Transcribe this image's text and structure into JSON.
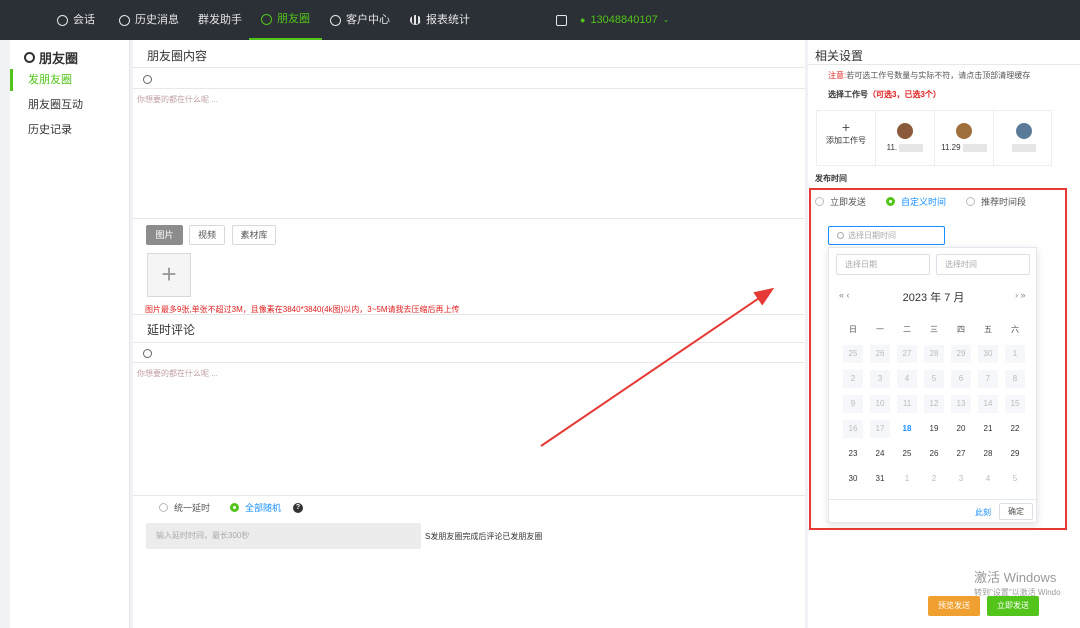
{
  "topnav": {
    "items": [
      {
        "label": "会话",
        "icon": "chat-icon"
      },
      {
        "label": "历史消息",
        "icon": "clock-icon"
      },
      {
        "label": "群发助手",
        "icon": ""
      },
      {
        "label": "朋友圈",
        "icon": "moments-icon",
        "active": true
      },
      {
        "label": "客户中心",
        "icon": "user-icon"
      },
      {
        "label": "报表统计",
        "icon": "bar-chart-icon"
      }
    ],
    "account_phone": "13048840107",
    "accent_color": "#52c41a"
  },
  "sidebar": {
    "title": "朋友圈",
    "items": [
      {
        "label": "发朋友圈",
        "active": true
      },
      {
        "label": "朋友圈互动"
      },
      {
        "label": "历史记录"
      }
    ]
  },
  "main": {
    "content_title": "朋友圈内容",
    "content_placeholder": "你想要的都在什么呢 ...",
    "media_tabs": [
      "图片",
      "视频",
      "素材库"
    ],
    "upload_plus": "+",
    "image_warning": "图片最多9张,单张不超过3M，且像素在3840*3840(4k图)以内，3~5M请我去压缩后再上传",
    "comment_title": "延时评论",
    "comment_placeholder": "你想要的都在什么呢 ...",
    "delay_options": [
      "统一延时",
      "全部随机"
    ],
    "help": "?",
    "delay_input_placeholder": "输入延时时间，最长300秒",
    "delay_note": "S发朋友圈完成后评论已发朋友圈"
  },
  "right": {
    "title": "相关设置",
    "notice_label": "注意:",
    "notice_text": "若可选工作号数量与实际不符，请点击顶部清理缓存",
    "pick_label": "选择工作号",
    "pick_count": "（可选3，已选3个）",
    "add_account": "添加工作号",
    "accounts": [
      {
        "name": "11.",
        "avatar_color": "#8a5a3a"
      },
      {
        "name": "11.29",
        "avatar_color": "#a0703a"
      },
      {
        "name": "",
        "avatar_color": "#5a7a9a"
      }
    ],
    "publish_time_label": "发布时间",
    "publish_options": [
      "立即发送",
      "自定义时间",
      "推荐时间段"
    ],
    "datetime_placeholder": "选择日期时间",
    "preview_button": "预览发送",
    "send_button": "立即发送"
  },
  "picker": {
    "date_placeholder": "选择日期",
    "time_placeholder": "选择时间",
    "prev": "«  ‹",
    "next": "›  »",
    "month_label": "2023 年  7 月",
    "weekdays": [
      "日",
      "一",
      "二",
      "三",
      "四",
      "五",
      "六"
    ],
    "rows": [
      [
        "25",
        "26",
        "27",
        "28",
        "29",
        "30",
        "1"
      ],
      [
        "2",
        "3",
        "4",
        "5",
        "6",
        "7",
        "8"
      ],
      [
        "9",
        "10",
        "11",
        "12",
        "13",
        "14",
        "15"
      ],
      [
        "16",
        "17",
        "18",
        "19",
        "20",
        "21",
        "22"
      ],
      [
        "23",
        "24",
        "25",
        "26",
        "27",
        "28",
        "29"
      ],
      [
        "30",
        "31",
        "1",
        "2",
        "3",
        "4",
        "5"
      ]
    ],
    "today": "18",
    "now_label": "此刻",
    "ok_label": "确定"
  },
  "watermark": {
    "line1": "激活 Windows",
    "line2": "转到\"设置\"以激活 Windo"
  }
}
